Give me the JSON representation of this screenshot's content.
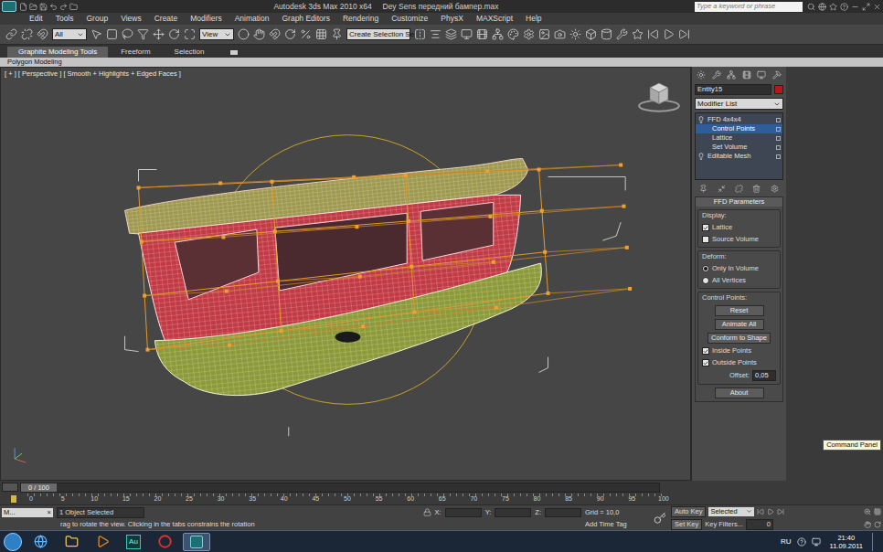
{
  "window": {
    "title": "Autodesk 3ds Max 2010 x64     Dey Sens передний бампер.max"
  },
  "search": {
    "placeholder": "Type a keyword or phrase"
  },
  "menu": [
    "Edit",
    "Tools",
    "Group",
    "Views",
    "Create",
    "Modifiers",
    "Animation",
    "Graph Editors",
    "Rendering",
    "Customize",
    "PhysX",
    "MAXScript",
    "Help"
  ],
  "toolbar": {
    "filter": "All",
    "reference": "View",
    "selection_set": "Create Selection Se"
  },
  "ribbon": {
    "tabs": [
      {
        "label": "Graphite Modeling Tools",
        "selected": true
      },
      {
        "label": "Freeform",
        "selected": false
      },
      {
        "label": "Selection",
        "selected": false
      }
    ],
    "panel": "Polygon Modeling"
  },
  "viewport": {
    "label": "[ + ] [ Perspective ] [ Smooth + Highlights + Edged Faces ]"
  },
  "command_panel": {
    "object_name": "Entity15",
    "modifier_list": "Modifier List",
    "stack": [
      {
        "label": "FFD 4x4x4",
        "child": false,
        "selected": false
      },
      {
        "label": "Control Points",
        "child": true,
        "selected": true
      },
      {
        "label": "Lattice",
        "child": true,
        "selected": false
      },
      {
        "label": "Set Volume",
        "child": true,
        "selected": false
      },
      {
        "label": "Editable Mesh",
        "child": false,
        "selected": false
      }
    ],
    "rollout": {
      "title": "FFD Parameters",
      "display": {
        "title": "Display:",
        "options": [
          {
            "label": "Lattice",
            "checked": true
          },
          {
            "label": "Source Volume",
            "checked": false
          }
        ]
      },
      "deform": {
        "title": "Deform:",
        "options": [
          {
            "label": "Only In Volume",
            "selected": true
          },
          {
            "label": "All Vertices",
            "selected": false
          }
        ]
      },
      "control_points": {
        "title": "Control Points:",
        "buttons": [
          "Reset",
          "Animate All",
          "Conform to Shape"
        ],
        "options": [
          {
            "label": "Inside Points",
            "checked": true
          },
          {
            "label": "Outside Points",
            "checked": true
          }
        ],
        "offset_label": "Offset:",
        "offset": "0,05"
      },
      "about": "About"
    }
  },
  "tooltip": "Command Panel",
  "timeline": {
    "position": "0 / 100",
    "ticks": [
      "0",
      "5",
      "10",
      "15",
      "20",
      "25",
      "30",
      "35",
      "40",
      "45",
      "50",
      "55",
      "60",
      "65",
      "70",
      "75",
      "80",
      "85",
      "90",
      "95",
      "100"
    ]
  },
  "status": {
    "mini_listener": "M...",
    "mini_close": "×",
    "selection": "1 Object Selected",
    "prompt": "rag to rotate the view. Clicking in the tabs constrains the rotation",
    "x_label": "X:",
    "y_label": "Y:",
    "z_label": "Z:",
    "grid": "Grid = 10,0",
    "add_time_tag": "Add Time Tag",
    "auto_key": "Auto Key",
    "key_mode": "Selected",
    "set_key": "Set Key",
    "key_filters": "Key Filters...",
    "frame": "0"
  },
  "taskbar": {
    "audition_badge": "Au",
    "language": "RU",
    "time": "21:40",
    "date": "11.09.2011"
  }
}
